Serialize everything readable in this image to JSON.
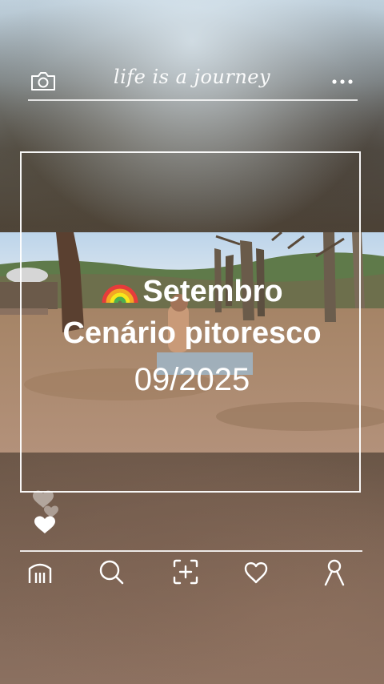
{
  "header": {
    "title": "life is a journey",
    "left_icon": "camera-icon",
    "right_icon": "more-icon"
  },
  "overlay": {
    "emoji_icon": "rainbow-icon",
    "line1": "Setembro",
    "line2": "Cenário pitoresco",
    "line3": "09/2025"
  },
  "reactions": {
    "icon": "hearts-icon"
  },
  "bottom_nav": {
    "items": [
      {
        "name": "home-icon"
      },
      {
        "name": "search-icon"
      },
      {
        "name": "add-icon"
      },
      {
        "name": "heart-icon"
      },
      {
        "name": "profile-icon"
      }
    ]
  },
  "colors": {
    "foreground": "#ffffff"
  }
}
